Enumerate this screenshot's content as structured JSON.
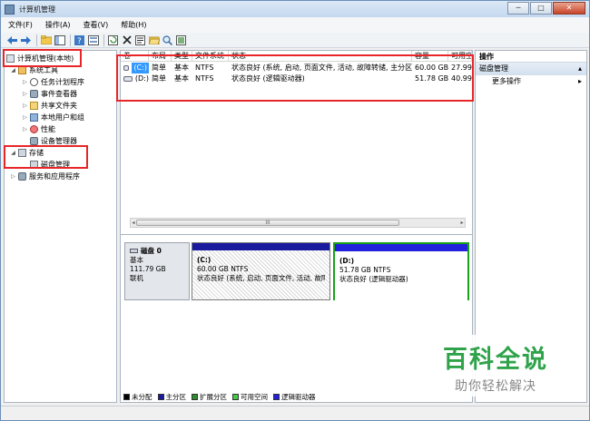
{
  "window": {
    "title": "计算机管理"
  },
  "window_controls": {
    "minimize": "─",
    "maximize": "□",
    "close": "✕"
  },
  "menu": [
    "文件(F)",
    "操作(A)",
    "查看(V)",
    "帮助(H)"
  ],
  "toolbar": {
    "icons": [
      "back-arrow-icon",
      "forward-arrow-icon",
      "up-folder-icon",
      "show-hide-tree-icon",
      "help-icon",
      "properties-icon",
      "refresh-icon",
      "delete-icon",
      "properties-sheet-icon",
      "open-icon",
      "search-icon",
      "export-icon"
    ]
  },
  "tree": {
    "root": "计算机管理(本地)",
    "system_tools": "系统工具",
    "task_scheduler": "任务计划程序",
    "event_viewer": "事件查看器",
    "shared_folders": "共享文件夹",
    "local_users": "本地用户和组",
    "performance": "性能",
    "device_manager": "设备管理器",
    "storage": "存储",
    "disk_management": "磁盘管理",
    "services_apps": "服务和应用程序"
  },
  "volume_list": {
    "columns": [
      "卷",
      "布局",
      "类型",
      "文件系统",
      "状态",
      "容量",
      "可用空"
    ],
    "rows": [
      {
        "volume": "(C:)",
        "layout": "简单",
        "type": "基本",
        "fs": "NTFS",
        "status": "状态良好 (系统, 启动, 页面文件, 活动, 故障转储, 主分区)",
        "capacity": "60.00 GB",
        "free": "27.99"
      },
      {
        "volume": "(D:)",
        "layout": "简单",
        "type": "基本",
        "fs": "NTFS",
        "status": "状态良好 (逻辑驱动器)",
        "capacity": "51.78 GB",
        "free": "40.99"
      }
    ]
  },
  "scrollbar": {
    "left": "◂",
    "right": "▸",
    "grip": "III"
  },
  "disk": {
    "name": "磁盘 0",
    "type": "基本",
    "size": "111.79 GB",
    "state": "联机",
    "partitions": [
      {
        "label": "(C:)",
        "size": "60.00 GB NTFS",
        "status": "状态良好 (系统, 启动, 页面文件, 活动, 故障"
      },
      {
        "label": "(D:)",
        "size": "51.78 GB NTFS",
        "status": "状态良好 (逻辑驱动器)"
      }
    ]
  },
  "legend": [
    {
      "label": "未分配",
      "color": "#000000"
    },
    {
      "label": "主分区",
      "color": "#1a1a9e"
    },
    {
      "label": "扩展分区",
      "color": "#2e8b2e"
    },
    {
      "label": "可用空间",
      "color": "#44cc44"
    },
    {
      "label": "逻辑驱动器",
      "color": "#2222dd"
    }
  ],
  "actions": {
    "title": "操作",
    "section": "磁盘管理",
    "section_arrow": "▴",
    "more": "更多操作",
    "more_arrow": "▸"
  },
  "watermark": {
    "main": "百科全说",
    "sub": "助你轻松解决"
  }
}
